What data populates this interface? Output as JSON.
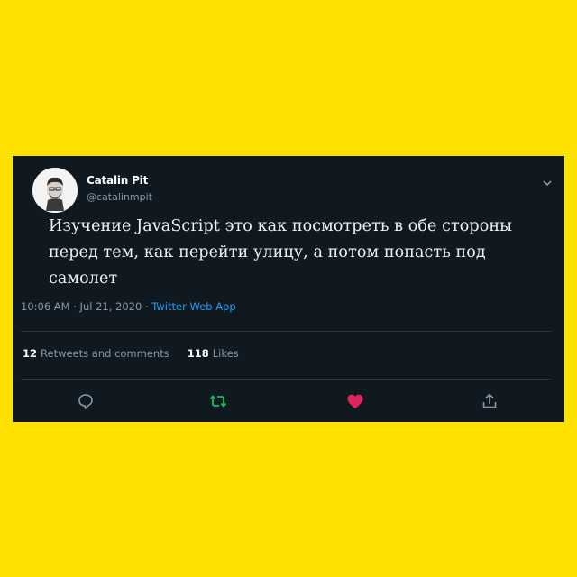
{
  "tweet": {
    "display_name": "Catalin Pit",
    "handle": "@catalinmpit",
    "text": "Изучение JavaScript это как посмотреть в обе стороны перед тем, как перейти улицу, а потом попасть под самолет",
    "timestamp": "10:06 AM · Jul 21, 2020 · ",
    "source": "Twitter Web App",
    "retweets_count": "12",
    "retweets_label": "Retweets and comments",
    "likes_count": "118",
    "likes_label": "Likes"
  },
  "icons": {
    "more": "chevron-down-icon",
    "reply": "reply-icon",
    "retweet": "retweet-icon",
    "like": "heart-icon",
    "share": "share-icon"
  },
  "colors": {
    "background": "#ffe100",
    "card": "#101820",
    "muted": "#8899a6",
    "link": "#1da1f2",
    "retweet": "#17bf63",
    "like": "#e0245e"
  }
}
